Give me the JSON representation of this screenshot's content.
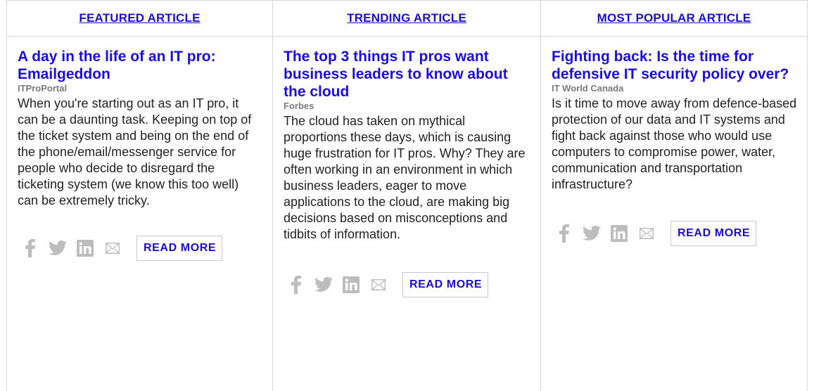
{
  "columns": [
    {
      "header": "FEATURED ARTICLE",
      "title": "A day in the life of an IT pro: Emailgeddon",
      "source": "ITProPortal",
      "description": "When you're starting out as an IT pro, it can be a daunting task. Keeping on top of the ticket system and being on the end of the phone/email/messenger service for people who decide to disregard the ticketing system (we know this too well) can be extremely tricky.",
      "read_more": "READ MORE"
    },
    {
      "header": "TRENDING ARTICLE",
      "title": "The top 3 things IT pros want business leaders to know about the cloud",
      "source": "Forbes",
      "description": "The cloud has taken on mythical proportions these days, which is causing huge frustration for IT pros. Why? They are often working in an environment in which business leaders, eager to move applications to the cloud, are making big decisions based on misconceptions and tidbits of information.",
      "read_more": "READ MORE"
    },
    {
      "header": "MOST POPULAR ARTICLE",
      "title": "Fighting back: Is the time for defensive IT security policy over?",
      "source": "IT World Canada",
      "description": "Is it time to move away from defence-based protection of our data and IT systems and fight back against those who would use computers to compromise power, water, communication and transportation infrastructure?",
      "read_more": "READ MORE"
    }
  ],
  "share_icons": [
    "facebook-icon",
    "twitter-icon",
    "linkedin-icon",
    "email-icon"
  ],
  "colors": {
    "link": "#1a0dcc",
    "source": "#7a7a7a",
    "icon": "#bdbdbd",
    "border": "#d8d8d8"
  }
}
